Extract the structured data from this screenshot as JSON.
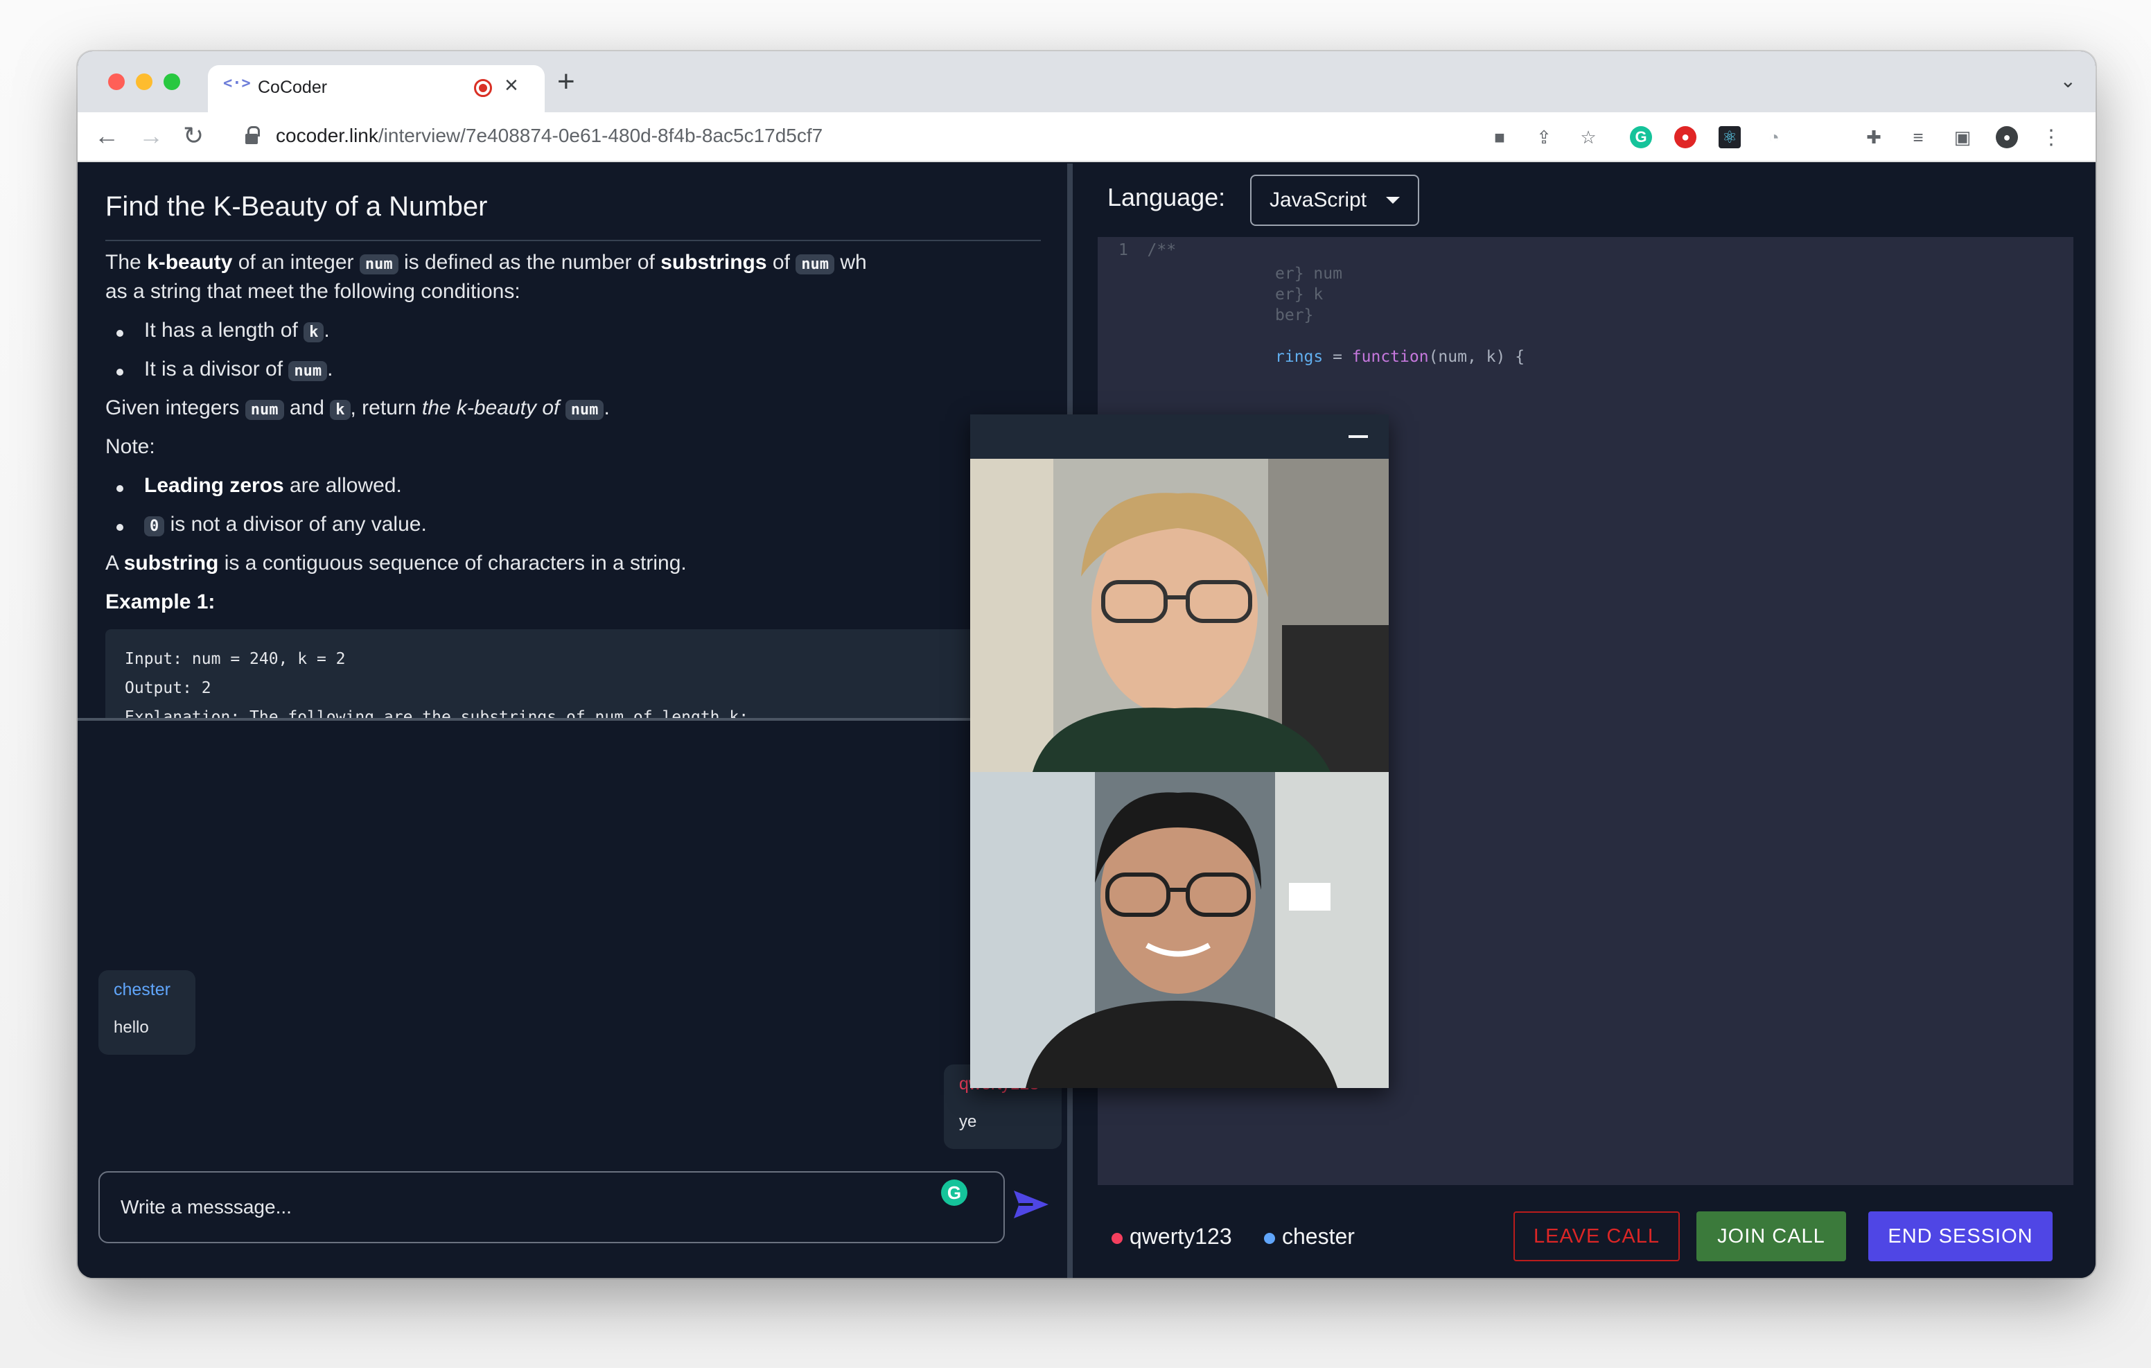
{
  "browser": {
    "tab_title": "CoCoder",
    "tab_icon": "code-icon",
    "url_host": "cocoder.link",
    "url_path": "/interview/7e408874-0e61-480d-8f4b-8ac5c17d5cf7"
  },
  "problem": {
    "title": "Find the K-Beauty of a Number",
    "p1_a": "The ",
    "p1_b": "k-beauty",
    "p1_c": " of an integer ",
    "p1_d": "num",
    "p1_e": " is defined as the number of ",
    "p1_f": "substrings",
    "p1_g": " of ",
    "p1_h": "num",
    "p1_i": " wh",
    "p1_line2": "as a string that meet the following conditions:",
    "b1_text": "It has a length of ",
    "b1_code": "k",
    "b1_end": ".",
    "b2_text": "It is a divisor of ",
    "b2_code": "num",
    "b2_end": ".",
    "p2_a": "Given integers ",
    "p2_b": "num",
    "p2_c": " and ",
    "p2_d": "k",
    "p2_e": ", return ",
    "p2_f": "the k-beauty of ",
    "p2_g": "num",
    "p2_h": ".",
    "note": "Note:",
    "n1_b": "Leading zeros",
    "n1_t": " are allowed.",
    "n2_code": "0",
    "n2_t": " is not a divisor of any value.",
    "p3_a": "A ",
    "p3_b": "substring",
    "p3_c": " is a contiguous sequence of characters in a string.",
    "example_title": "Example 1:",
    "example_code": "Input: num = 240, k = 2\nOutput: 2\nExplanation: The following are the substrings of num of length k:"
  },
  "chat": {
    "messages": [
      {
        "user": "chester",
        "text": "hello",
        "color": "#60a5fa"
      },
      {
        "user": "qwerty123",
        "text": "ye",
        "color": "#f43f5e"
      }
    ],
    "placeholder": "Write a messsage..."
  },
  "editor": {
    "language_label": "Language:",
    "language": "JavaScript",
    "code": {
      "l1": "1  /**",
      "l2": "er} num",
      "l3": "er} k",
      "l4": "ber}",
      "l5_a": "rings",
      "l5_b": " = ",
      "l5_c": "function",
      "l5_d": "(num, k) {"
    }
  },
  "session": {
    "participants": [
      {
        "name": "qwerty123",
        "color": "#f43f5e"
      },
      {
        "name": "chester",
        "color": "#60a5fa"
      }
    ],
    "leave_call": "LEAVE CALL",
    "join_call": "JOIN CALL",
    "end_session": "END SESSION"
  },
  "colors": {
    "bg": "#111827",
    "editor_bg": "#282c3f",
    "join_green": "#3b7a3b",
    "end_blue": "#4f46e5",
    "leave_red": "#dc2626"
  }
}
